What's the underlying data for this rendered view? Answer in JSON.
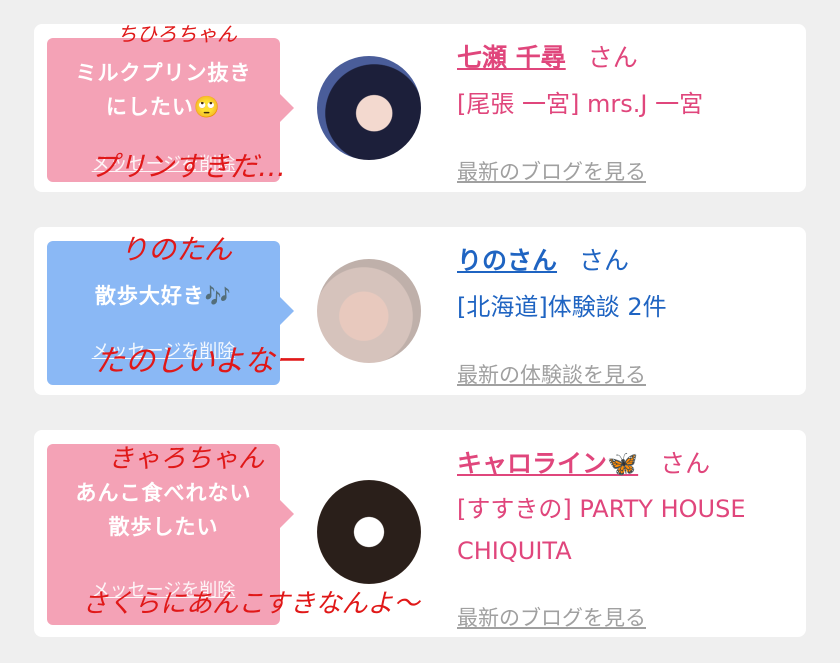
{
  "cards": [
    {
      "message": "ミルクプリン抜き\nにしたい🙄",
      "delete_label": "メッセージを削除",
      "name": "七瀬 千尋",
      "honorific": "さん",
      "shop": "[尾張 一宮] mrs.J 一宮",
      "more_link": "最新のブログを見る",
      "annotation_top": "ちひろちゃん",
      "annotation_bottom": "プリンすきだ…"
    },
    {
      "message": "散歩大好き🎶",
      "delete_label": "メッセージを削除",
      "name": "りのさん",
      "honorific": "さん",
      "shop": "[北海道]体験談 2件",
      "more_link": "最新の体験談を見る",
      "annotation_top": "りのたん",
      "annotation_bottom": "たのしいよなー"
    },
    {
      "message": "あんこ食べれない\n散歩したい",
      "delete_label": "メッセージを削除",
      "name": "キャロライン🦋",
      "honorific": "さん",
      "shop_line1": "[すすきの] PARTY HOUSE",
      "shop_line2": "CHIQUITA",
      "more_link": "最新のブログを見る",
      "annotation_top": "きゃろちゃん",
      "annotation_bottom": "さくらにあんこすきなんよ〜"
    }
  ],
  "colors": {
    "pink": "#f4a2b6",
    "blue": "#8ab8f5",
    "pink_text": "#e0467c",
    "blue_text": "#1f64c2",
    "annotation": "#e01818"
  }
}
